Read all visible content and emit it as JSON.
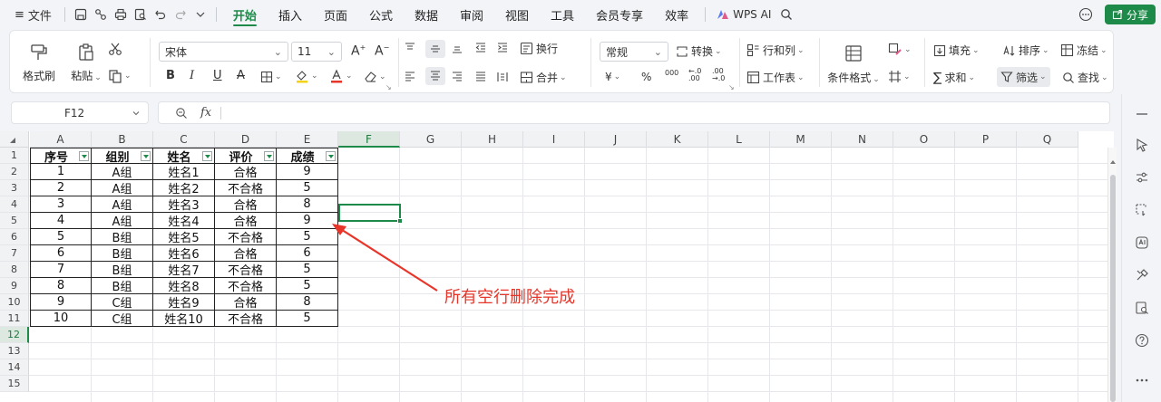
{
  "menubar": {
    "menu_icon": "≡",
    "file_label": "文件",
    "tabs": [
      "开始",
      "插入",
      "页面",
      "公式",
      "数据",
      "审阅",
      "视图",
      "工具",
      "会员专享",
      "效率"
    ],
    "active_tab": "开始",
    "wps_ai_label": "WPS AI",
    "share_label": "分享"
  },
  "ribbon": {
    "format_painter": "格式刷",
    "paste": "粘贴",
    "font_name": "宋体",
    "font_size": "11",
    "wrap": "换行",
    "merge": "合并",
    "number_format": "常规",
    "convert": "转换",
    "row_col": "行和列",
    "worksheet": "工作表",
    "cond_format": "条件格式",
    "fill": "填充",
    "sort": "排序",
    "freeze": "冻结",
    "sum": "求和",
    "filter": "筛选",
    "find": "查找",
    "yuan": "¥",
    "percent": "%",
    "thousands": "000",
    "dec_inc": "←.0\n.00",
    "dec_dec": ".00\n→.0"
  },
  "formula_bar": {
    "cell_ref": "F12",
    "fx": "fx",
    "value": ""
  },
  "columns": [
    "A",
    "B",
    "C",
    "D",
    "E",
    "F",
    "G",
    "H",
    "I",
    "J",
    "K",
    "L",
    "M",
    "N",
    "O",
    "P",
    "Q"
  ],
  "rows": [
    "1",
    "2",
    "3",
    "4",
    "5",
    "6",
    "7",
    "8",
    "9",
    "10",
    "11",
    "12",
    "13",
    "14",
    "15"
  ],
  "table": {
    "headers": [
      "序号",
      "组别",
      "姓名",
      "评价",
      "成绩"
    ],
    "data": [
      [
        "1",
        "A组",
        "姓名1",
        "合格",
        "9"
      ],
      [
        "2",
        "A组",
        "姓名2",
        "不合格",
        "5"
      ],
      [
        "3",
        "A组",
        "姓名3",
        "合格",
        "8"
      ],
      [
        "4",
        "A组",
        "姓名4",
        "合格",
        "9"
      ],
      [
        "5",
        "B组",
        "姓名5",
        "不合格",
        "5"
      ],
      [
        "6",
        "B组",
        "姓名6",
        "合格",
        "6"
      ],
      [
        "7",
        "B组",
        "姓名7",
        "不合格",
        "5"
      ],
      [
        "8",
        "B组",
        "姓名8",
        "不合格",
        "5"
      ],
      [
        "9",
        "C组",
        "姓名9",
        "合格",
        "8"
      ],
      [
        "10",
        "C组",
        "姓名10",
        "不合格",
        "5"
      ]
    ]
  },
  "selected_cell": "F12",
  "annotation": "所有空行删除完成",
  "colors": {
    "accent": "#1e8a4a",
    "annotation": "#e8352a"
  }
}
